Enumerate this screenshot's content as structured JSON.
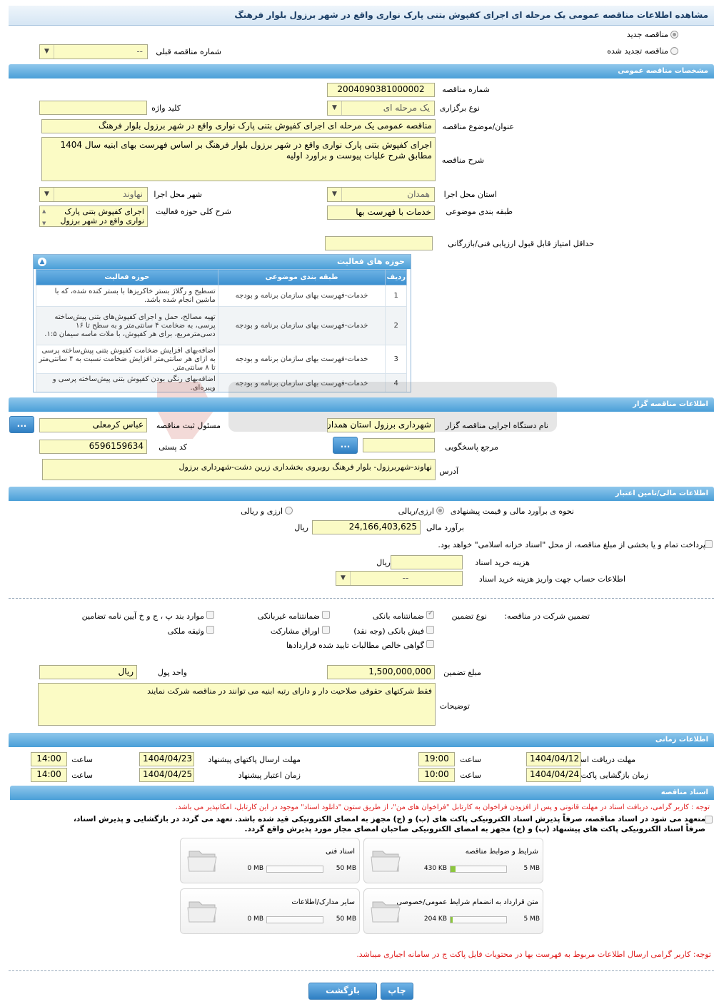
{
  "title": "مشاهده اطلاعات مناقصه عمومی یک مرحله ای اجرای کفپوش بتنی پارک نواری واقع در شهر برزول بلوار فرهنگ",
  "header": {
    "new_tender_label": "مناقصه جدید",
    "renewed_tender_label": "مناقصه تجدید شده",
    "prev_tender_label": "شماره مناقصه قبلی",
    "prev_tender_value": "--"
  },
  "general": {
    "section_title": "مشخصات مناقصه عمومی",
    "tender_number_label": "شماره مناقصه",
    "tender_number": "2004090381000002",
    "type_label": "نوع برگزاری",
    "type_value": "یک مرحله ای",
    "keyword_label": "کلید واژه",
    "keyword_value": "",
    "subject_label": "عنوان/موضوع مناقصه",
    "subject_value": "مناقصه عمومی یک مرحله ای اجرای کفپوش بتنی پارک نواری واقع در شهر برزول بلوار فرهنگ",
    "desc_label": "شرح مناقصه",
    "desc_value": "اجرای کفپوش بتنی پارک نواری واقع در شهر برزول بلوار فرهنگ بر اساس فهرست بهای ابنیه سال 1404 مطابق شرح علیات پیوست و براورد اولیه",
    "province_label": "استان محل اجرا",
    "province_value": "همدان",
    "city_label": "شهر محل اجرا",
    "city_value": "نهاوند",
    "category_label": "طبقه بندی موضوعی",
    "category_value": "خدمات با فهرست بها",
    "scope_label": "شرح کلی حوزه فعالیت",
    "scope_value": "اجرای کفپوش بتنی پارک نواری واقع در شهر برزول",
    "min_score_label": "حداقل امتیاز قابل قبول ارزیابی فنی/بازرگانی",
    "min_score_value": ""
  },
  "activities": {
    "title": "حوزه های فعالیت",
    "headers": [
      "ردیف",
      "طبقه بندی موضوعی",
      "حوزه فعالیت"
    ],
    "rows": [
      {
        "n": "1",
        "cat": "خدمات-فهرست بهای سازمان برنامه و بودجه",
        "area": "تسطیح و رگلاژ بستر خاکریزها با بستر کنده شده، که با ماشین انجام شده باشد."
      },
      {
        "n": "2",
        "cat": "خدمات-فهرست بهای سازمان برنامه و بودجه",
        "area": "تهیه مصالح، حمل و اجرای کفپوش‌های بتنی پیش‌ساخته پرسی، به ضخامت ۴ سانتی‌متر و به سطح تا ۱۶ دسی‌مترمربع، برای هر کفپوش، با ملات ماسه سیمان ۱:۵."
      },
      {
        "n": "3",
        "cat": "خدمات-فهرست بهای سازمان برنامه و بودجه",
        "area": "اضافه‌بهای افزایش ضخامت کفپوش بتنی پیش‌ساخته پرسی به ازای هر سانتی‌متر افزایش ضخامت نسبت به ۴ سانتی‌متر تا ۸ سانتی‌متر."
      },
      {
        "n": "4",
        "cat": "خدمات-فهرست بهای سازمان برنامه و بودجه",
        "area": "اضافه‌بهای رنگی بودن کفپوش بتنی پیش‌ساخته پرسی و ویبره‌ای."
      }
    ]
  },
  "organizer": {
    "section_title": "اطلاعات مناقصه گزار",
    "agency_label": "نام دستگاه اجرایی مناقصه گزار",
    "agency_value": "شهرداری برزول استان همدان",
    "registrar_label": "مسئول ثبت مناقصه",
    "registrar_value": "عباس کرمعلی",
    "respond_label": "مرجع پاسخگویی",
    "respond_value": "",
    "postal_label": "کد پستی",
    "postal_value": "6596159634",
    "address_label": "آدرس",
    "address_value": "نهاوند-شهربرزول- بلوار فرهنگ روبروی بخشداری زرین دشت-شهرداری برزول",
    "more_button": "..."
  },
  "finance": {
    "section_title": "اطلاعات مالی/تامین اعتبار",
    "estimate_method_label": "نحوه ی برآورد مالی و قیمت پیشنهادی",
    "opt_rial": "ارزی/ریالی",
    "opt_fx": "ارزی و ریالی",
    "estimate_label": "برآورد مالی",
    "estimate_value": "24,166,403,625",
    "rial": "ریال",
    "treasury_note": "پرداخت تمام و یا بخشی از مبلغ مناقصه، از محل \"اسناد خزانه اسلامی\" خواهد بود.",
    "doc_fee_label": "هزینه خرید اسناد",
    "doc_fee_value": "",
    "account_label": "اطلاعات حساب جهت واریز هزینه خرید اسناد",
    "account_value": "--"
  },
  "guarantee": {
    "participation_label": "تضمین شرکت در مناقصه:",
    "type_label": "نوع تضمین",
    "items": {
      "bank": "ضمانتنامه بانکی",
      "nonbank": "ضمانتنامه غیربانکی",
      "article": "موارد بند پ ، ج و خ آیین نامه تضامین",
      "cash": "فیش بانکی (وجه نقد)",
      "bonds": "اوراق مشارکت",
      "property": "وثیقه ملکی",
      "claims": "گواهی خالص مطالبات تایید شده قراردادها"
    },
    "amount_label": "مبلغ تضمین",
    "amount_value": "1,500,000,000",
    "currency_label": "واحد پول",
    "currency_value": "ریال",
    "notes_label": "توضیحات",
    "notes_value": "فقط شرکتهای حقوقی صلاحیت دار و دارای رتبه ابنیه می توانند در مناقصه شرکت نمایند"
  },
  "timing": {
    "section_title": "اطلاعات زمانی",
    "doc_receive_label": "مهلت دریافت اسناد",
    "doc_receive_date": "1404/04/12",
    "doc_receive_time": "19:00",
    "send_deadline_label": "مهلت ارسال پاکتهای پیشنهاد",
    "send_deadline_date": "1404/04/23",
    "send_deadline_time": "14:00",
    "open_label": "زمان بازگشایی پاکت ها",
    "open_date": "1404/04/24",
    "open_time": "10:00",
    "validity_label": "زمان اعتبار پیشنهاد",
    "validity_date": "1404/04/25",
    "validity_time": "14:00",
    "time_label": "ساعت"
  },
  "documents": {
    "section_title": "اسناد مناقصه",
    "note1": "توجه : کاربر گرامی، دریافت اسناد در مهلت قانونی و پس از افزودن فراخوان به کارتابل \"فراخوان های من\"، از طریق ستون \"دانلود اسناد\" موجود در این کارتابل، امکانپذیر می باشد.",
    "commit_line1": "متعهد می شود در اسناد مناقصه، صرفاً پذیرش اسناد الکترونیکی پاکت های (ب) و (ج) مجهز به امضای الکترونیکی قید شده باشد. تعهد می گردد در بازگشایی و پذیرش اسناد،",
    "commit_line2": "صرفاً اسناد الکترونیکی پاکت های پیشنهاد (ب) و (ج) مجهز به امضای الکترونیکی صاحبان امضای مجاز مورد پذیرش واقع گردد.",
    "files": [
      {
        "name": "شرایط و ضوابط مناقصه",
        "cur": "430 KB",
        "max": "5 MB",
        "fill": 0.09
      },
      {
        "name": "اسناد فنی",
        "cur": "0 MB",
        "max": "50 MB",
        "fill": 0
      },
      {
        "name": "متن قرارداد به انضمام شرایط عمومی/خصوصی",
        "cur": "204 KB",
        "max": "5 MB",
        "fill": 0.04
      },
      {
        "name": "سایر مدارک/اطلاعات",
        "cur": "0 MB",
        "max": "50 MB",
        "fill": 0
      }
    ],
    "note2": "توجه: کاربر گرامی ارسال اطلاعات مربوط به فهرست بها در محتویات فایل پاکت ج در سامانه اجباری میباشد."
  },
  "footer": {
    "back_button": "بازگشت",
    "print_button": "چاپ"
  },
  "colors": {
    "section_blue": "#4a9fd8",
    "field_yellow": "#fbfbc5",
    "note_red": "#e02020"
  }
}
